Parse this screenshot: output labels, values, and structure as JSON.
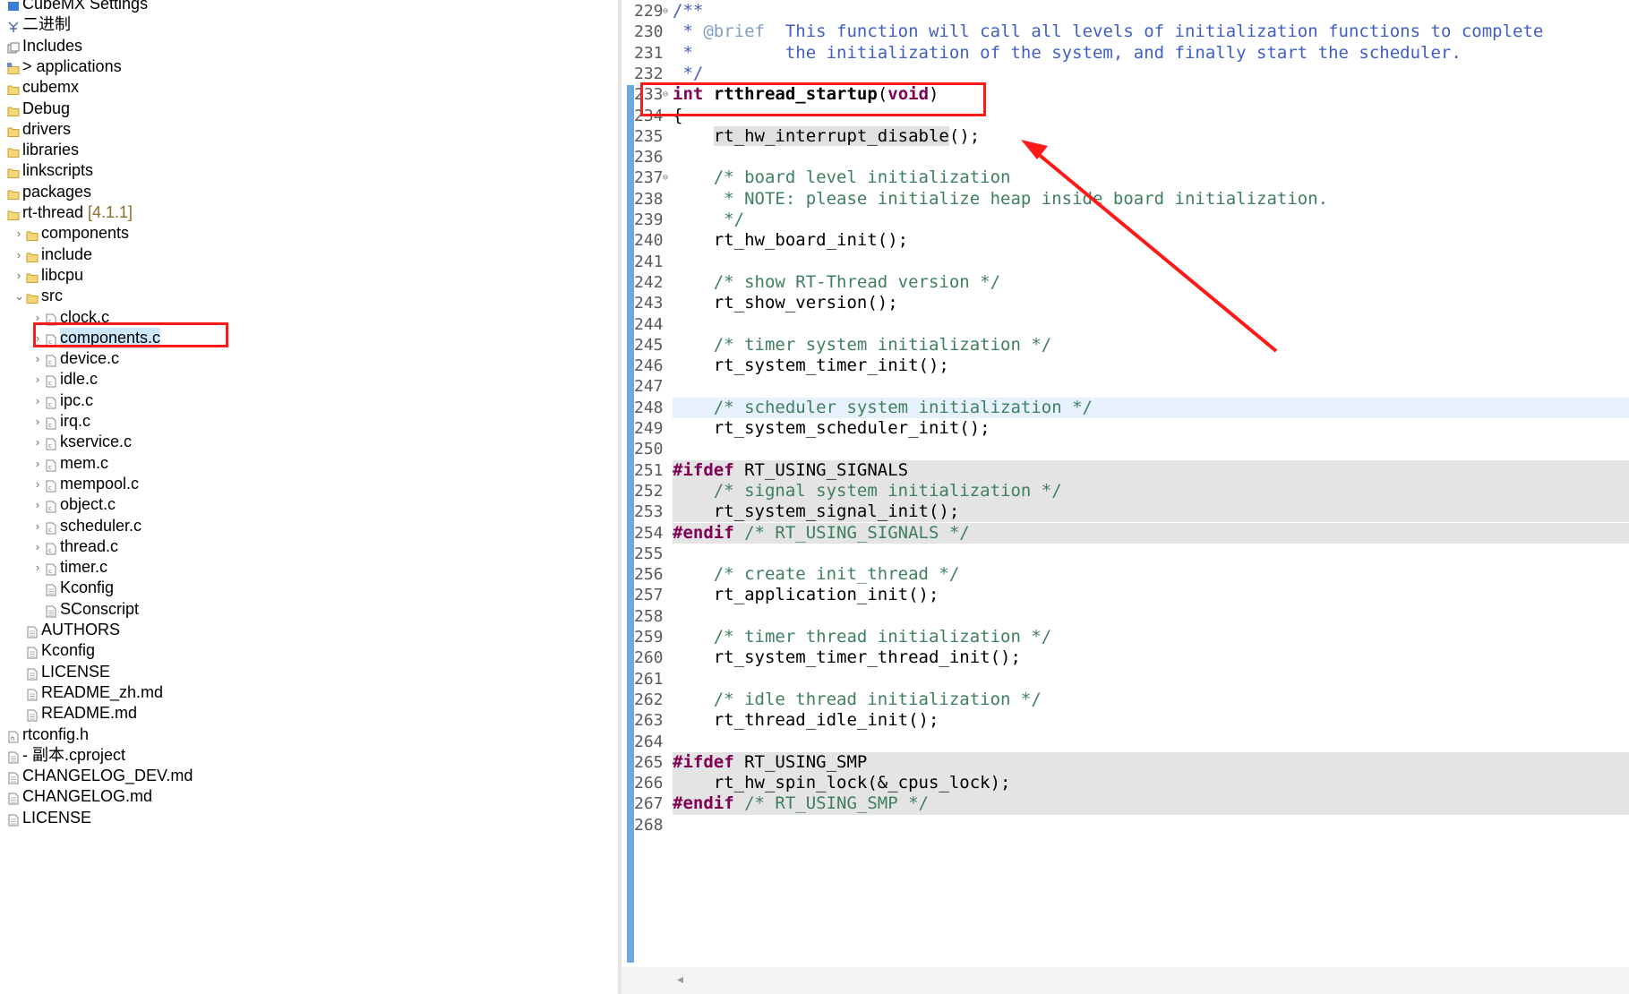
{
  "project_tree": {
    "items": [
      {
        "label": "CubeMX Settings",
        "indent": 0,
        "chevron": "",
        "icon": "settings-icon",
        "icon_color": "#3a7bd5"
      },
      {
        "label": "二进制",
        "indent": 0,
        "chevron": "",
        "icon": "binaries-icon",
        "icon_color": "#4a6aa8"
      },
      {
        "label": "Includes",
        "indent": 0,
        "chevron": "",
        "icon": "includes-icon",
        "icon_color": "#6b6b6b"
      },
      {
        "label": "> applications",
        "indent": 0,
        "chevron": "",
        "icon": "source-folder-icon",
        "icon_color": "#c9a227"
      },
      {
        "label": "cubemx",
        "indent": 0,
        "chevron": "",
        "icon": "folder-icon",
        "icon_color": "#c9a227"
      },
      {
        "label": "Debug",
        "indent": 0,
        "chevron": "",
        "icon": "folder-icon",
        "icon_color": "#c9a227"
      },
      {
        "label": "drivers",
        "indent": 0,
        "chevron": "",
        "icon": "folder-icon",
        "icon_color": "#c9a227"
      },
      {
        "label": "libraries",
        "indent": 0,
        "chevron": "",
        "icon": "folder-icon",
        "icon_color": "#c9a227"
      },
      {
        "label": "linkscripts",
        "indent": 0,
        "chevron": "",
        "icon": "folder-icon",
        "icon_color": "#c9a227"
      },
      {
        "label": "packages",
        "indent": 0,
        "chevron": "",
        "icon": "folder-icon",
        "icon_color": "#c9a227"
      },
      {
        "label": "rt-thread",
        "tag": "[4.1.1]",
        "indent": 0,
        "chevron": "",
        "icon": "folder-icon",
        "icon_color": "#c9a227"
      },
      {
        "label": "components",
        "indent": 1,
        "chevron": "›",
        "icon": "folder-icon",
        "icon_color": "#c9a227"
      },
      {
        "label": "include",
        "indent": 1,
        "chevron": "›",
        "icon": "folder-icon",
        "icon_color": "#c9a227"
      },
      {
        "label": "libcpu",
        "indent": 1,
        "chevron": "›",
        "icon": "folder-icon",
        "icon_color": "#c9a227"
      },
      {
        "label": "src",
        "indent": 1,
        "chevron": "⌄",
        "icon": "folder-icon",
        "icon_color": "#c9a227"
      },
      {
        "label": "clock.c",
        "indent": 2,
        "chevron": "›",
        "icon": "c-file-icon",
        "icon_color": "#8a6a3a"
      },
      {
        "label": "components.c",
        "indent": 2,
        "chevron": "›",
        "icon": "c-file-icon",
        "icon_color": "#8a6a3a",
        "selected": true
      },
      {
        "label": "device.c",
        "indent": 2,
        "chevron": "›",
        "icon": "c-file-icon",
        "icon_color": "#8a6a3a"
      },
      {
        "label": "idle.c",
        "indent": 2,
        "chevron": "›",
        "icon": "c-file-icon",
        "icon_color": "#8a6a3a"
      },
      {
        "label": "ipc.c",
        "indent": 2,
        "chevron": "›",
        "icon": "c-file-icon",
        "icon_color": "#8a6a3a"
      },
      {
        "label": "irq.c",
        "indent": 2,
        "chevron": "›",
        "icon": "c-file-icon",
        "icon_color": "#8a6a3a"
      },
      {
        "label": "kservice.c",
        "indent": 2,
        "chevron": "›",
        "icon": "c-file-icon",
        "icon_color": "#8a6a3a"
      },
      {
        "label": "mem.c",
        "indent": 2,
        "chevron": "›",
        "icon": "c-file-icon",
        "icon_color": "#8a6a3a"
      },
      {
        "label": "mempool.c",
        "indent": 2,
        "chevron": "›",
        "icon": "c-file-icon",
        "icon_color": "#8a6a3a"
      },
      {
        "label": "object.c",
        "indent": 2,
        "chevron": "›",
        "icon": "c-file-icon",
        "icon_color": "#8a6a3a"
      },
      {
        "label": "scheduler.c",
        "indent": 2,
        "chevron": "›",
        "icon": "c-file-icon",
        "icon_color": "#8a6a3a"
      },
      {
        "label": "thread.c",
        "indent": 2,
        "chevron": "›",
        "icon": "c-file-icon",
        "icon_color": "#8a6a3a"
      },
      {
        "label": "timer.c",
        "indent": 2,
        "chevron": "›",
        "icon": "c-file-icon",
        "icon_color": "#8a6a3a"
      },
      {
        "label": "Kconfig",
        "indent": 2,
        "chevron": "",
        "icon": "text-file-icon",
        "icon_color": "#8a8a8a"
      },
      {
        "label": "SConscript",
        "indent": 2,
        "chevron": "",
        "icon": "text-file-icon",
        "icon_color": "#8a8a8a"
      },
      {
        "label": "AUTHORS",
        "indent": 1,
        "chevron": "",
        "icon": "text-file-icon",
        "icon_color": "#8a8a8a"
      },
      {
        "label": "Kconfig",
        "indent": 1,
        "chevron": "",
        "icon": "text-file-icon",
        "icon_color": "#8a8a8a"
      },
      {
        "label": "LICENSE",
        "indent": 1,
        "chevron": "",
        "icon": "text-file-icon",
        "icon_color": "#8a8a8a"
      },
      {
        "label": "README_zh.md",
        "indent": 1,
        "chevron": "",
        "icon": "text-file-icon",
        "icon_color": "#8a8a8a"
      },
      {
        "label": "README.md",
        "indent": 1,
        "chevron": "",
        "icon": "text-file-icon",
        "icon_color": "#8a8a8a"
      },
      {
        "label": "rtconfig.h",
        "indent": 0,
        "chevron": "",
        "icon": "h-file-icon",
        "icon_color": "#8a6a3a"
      },
      {
        "label": "- 副本.cproject",
        "indent": 0,
        "chevron": "",
        "icon": "text-file-icon",
        "icon_color": "#8a8a8a"
      },
      {
        "label": "CHANGELOG_DEV.md",
        "indent": 0,
        "chevron": "",
        "icon": "text-file-icon",
        "icon_color": "#8a8a8a"
      },
      {
        "label": "CHANGELOG.md",
        "indent": 0,
        "chevron": "",
        "icon": "text-file-icon",
        "icon_color": "#8a8a8a"
      },
      {
        "label": "LICENSE",
        "indent": 0,
        "chevron": "",
        "icon": "text-file-icon",
        "icon_color": "#8a8a8a"
      }
    ]
  },
  "editor": {
    "lines": [
      {
        "n": "229",
        "fold": "⊖",
        "tokens": [
          [
            "doc",
            "/**"
          ]
        ]
      },
      {
        "n": "230",
        "tokens": [
          [
            "doc",
            " * "
          ],
          [
            "tg",
            "@brief"
          ],
          [
            "doc",
            "  This function will call all levels of initialization functions to complete"
          ]
        ]
      },
      {
        "n": "231",
        "tokens": [
          [
            "doc",
            " *         the initialization of the system, and finally start the scheduler."
          ]
        ]
      },
      {
        "n": "232",
        "tokens": [
          [
            "doc",
            " */"
          ]
        ]
      },
      {
        "n": "233",
        "fold": "⊖",
        "tokens": [
          [
            "kw",
            "int"
          ],
          [
            "",
            " "
          ],
          [
            "bold",
            "rtthread_startup"
          ],
          [
            "",
            "("
          ],
          [
            "kw",
            "void"
          ],
          [
            "",
            ")"
          ]
        ]
      },
      {
        "n": "234",
        "tokens": [
          [
            "",
            "{"
          ]
        ]
      },
      {
        "n": "235",
        "tokens": [
          [
            "",
            "    "
          ],
          [
            "occ",
            "rt_hw_interrupt_disable"
          ],
          [
            "",
            "();"
          ]
        ]
      },
      {
        "n": "236",
        "tokens": []
      },
      {
        "n": "237",
        "fold": "⊖",
        "tokens": [
          [
            "cm",
            "    /* board level initialization"
          ]
        ]
      },
      {
        "n": "238",
        "tokens": [
          [
            "cm",
            "     * NOTE: please initialize heap inside board initialization."
          ]
        ]
      },
      {
        "n": "239",
        "tokens": [
          [
            "cm",
            "     */"
          ]
        ]
      },
      {
        "n": "240",
        "tokens": [
          [
            "",
            "    rt_hw_board_init();"
          ]
        ]
      },
      {
        "n": "241",
        "tokens": []
      },
      {
        "n": "242",
        "tokens": [
          [
            "cm",
            "    /* show RT-Thread version */"
          ]
        ]
      },
      {
        "n": "243",
        "tokens": [
          [
            "",
            "    rt_show_version();"
          ]
        ]
      },
      {
        "n": "244",
        "tokens": []
      },
      {
        "n": "245",
        "tokens": [
          [
            "cm",
            "    /* timer system initialization */"
          ]
        ]
      },
      {
        "n": "246",
        "tokens": [
          [
            "",
            "    rt_system_timer_init();"
          ]
        ]
      },
      {
        "n": "247",
        "tokens": []
      },
      {
        "n": "248",
        "current": true,
        "tokens": [
          [
            "cm",
            "    /* scheduler system initialization */"
          ]
        ]
      },
      {
        "n": "249",
        "tokens": [
          [
            "",
            "    rt_system_scheduler_init();"
          ]
        ]
      },
      {
        "n": "250",
        "tokens": []
      },
      {
        "n": "251",
        "inactive": true,
        "tokens": [
          [
            "kw",
            "#ifdef"
          ],
          [
            "",
            " RT_USING_SIGNALS"
          ]
        ]
      },
      {
        "n": "252",
        "inactive": true,
        "tokens": [
          [
            "cm",
            "    /* signal system initialization */"
          ]
        ]
      },
      {
        "n": "253",
        "inactive": true,
        "tokens": [
          [
            "",
            "    rt_system_signal_init();"
          ]
        ]
      },
      {
        "n": "254",
        "inactive": true,
        "tokens": [
          [
            "kw",
            "#endif"
          ],
          [
            "",
            " "
          ],
          [
            "cm",
            "/* RT_USING_SIGNALS */"
          ]
        ]
      },
      {
        "n": "255",
        "tokens": []
      },
      {
        "n": "256",
        "tokens": [
          [
            "cm",
            "    /* create init_thread */"
          ]
        ]
      },
      {
        "n": "257",
        "tokens": [
          [
            "",
            "    rt_application_init();"
          ]
        ]
      },
      {
        "n": "258",
        "tokens": []
      },
      {
        "n": "259",
        "tokens": [
          [
            "cm",
            "    /* timer thread initialization */"
          ]
        ]
      },
      {
        "n": "260",
        "tokens": [
          [
            "",
            "    rt_system_timer_thread_init();"
          ]
        ]
      },
      {
        "n": "261",
        "tokens": []
      },
      {
        "n": "262",
        "tokens": [
          [
            "cm",
            "    /* idle thread initialization */"
          ]
        ]
      },
      {
        "n": "263",
        "tokens": [
          [
            "",
            "    rt_thread_idle_init();"
          ]
        ]
      },
      {
        "n": "264",
        "tokens": []
      },
      {
        "n": "265",
        "inactive": true,
        "tokens": [
          [
            "kw",
            "#ifdef"
          ],
          [
            "",
            " RT_USING_SMP"
          ]
        ]
      },
      {
        "n": "266",
        "inactive": true,
        "tokens": [
          [
            "",
            "    rt_hw_spin_lock(&_cpus_lock);"
          ]
        ]
      },
      {
        "n": "267",
        "inactive": true,
        "tokens": [
          [
            "kw",
            "#endif"
          ],
          [
            "",
            " "
          ],
          [
            "cm",
            "/* RT_USING_SMP */"
          ]
        ]
      },
      {
        "n": "268",
        "tokens": []
      }
    ]
  },
  "scrollbar": {
    "left_arrow": "◂"
  },
  "colors": {
    "annotation": "#ff1a1a",
    "selection": "#cce8ff",
    "folder": "#c9a227"
  }
}
